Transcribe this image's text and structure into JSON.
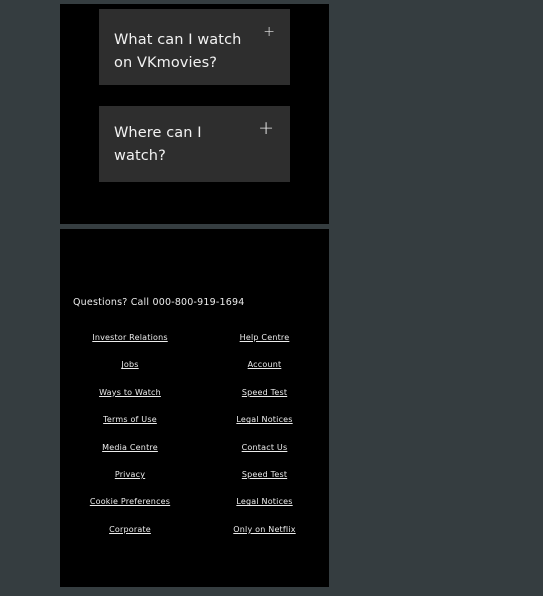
{
  "faq": {
    "items": [
      {
        "question": "What can I watch on VKmovies?",
        "icon": "plus-icon"
      },
      {
        "question": "Where can I watch?",
        "icon": "plus-icon"
      }
    ]
  },
  "footer": {
    "contact": "Questions? Call 000-800-919-1694",
    "links": [
      "Investor Relations",
      "Help Centre",
      "Jobs",
      "Account",
      "Ways to Watch",
      "Speed Test",
      "Terms of Use",
      "Legal Notices",
      "Media Centre",
      "Contact Us",
      "Privacy",
      "Speed Test",
      "Cookie Preferences",
      "Legal Notices",
      "Corporate",
      "Only on Netflix"
    ]
  }
}
